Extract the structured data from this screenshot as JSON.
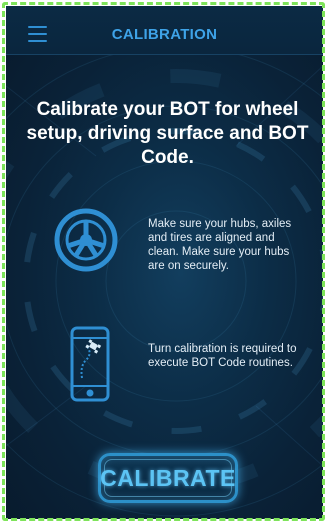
{
  "header": {
    "title": "CALIBRATION",
    "menu_icon": "hamburger-menu-icon"
  },
  "headline": "Calibrate your BOT for wheel setup, driving surface and BOT Code.",
  "rows": [
    {
      "icon": "wheel-icon",
      "text": "Make sure your hubs, axiles and tires are aligned and clean.  Make sure your hubs are on securely."
    },
    {
      "icon": "phone-turn-icon",
      "text": "Turn calibration is required to execute BOT Code routines."
    }
  ],
  "calibrate_button": {
    "label": "CALIBRATE"
  },
  "colors": {
    "accent": "#3ea3e8",
    "background": "#0a2238",
    "frame_highlight": "#7ee35a"
  }
}
